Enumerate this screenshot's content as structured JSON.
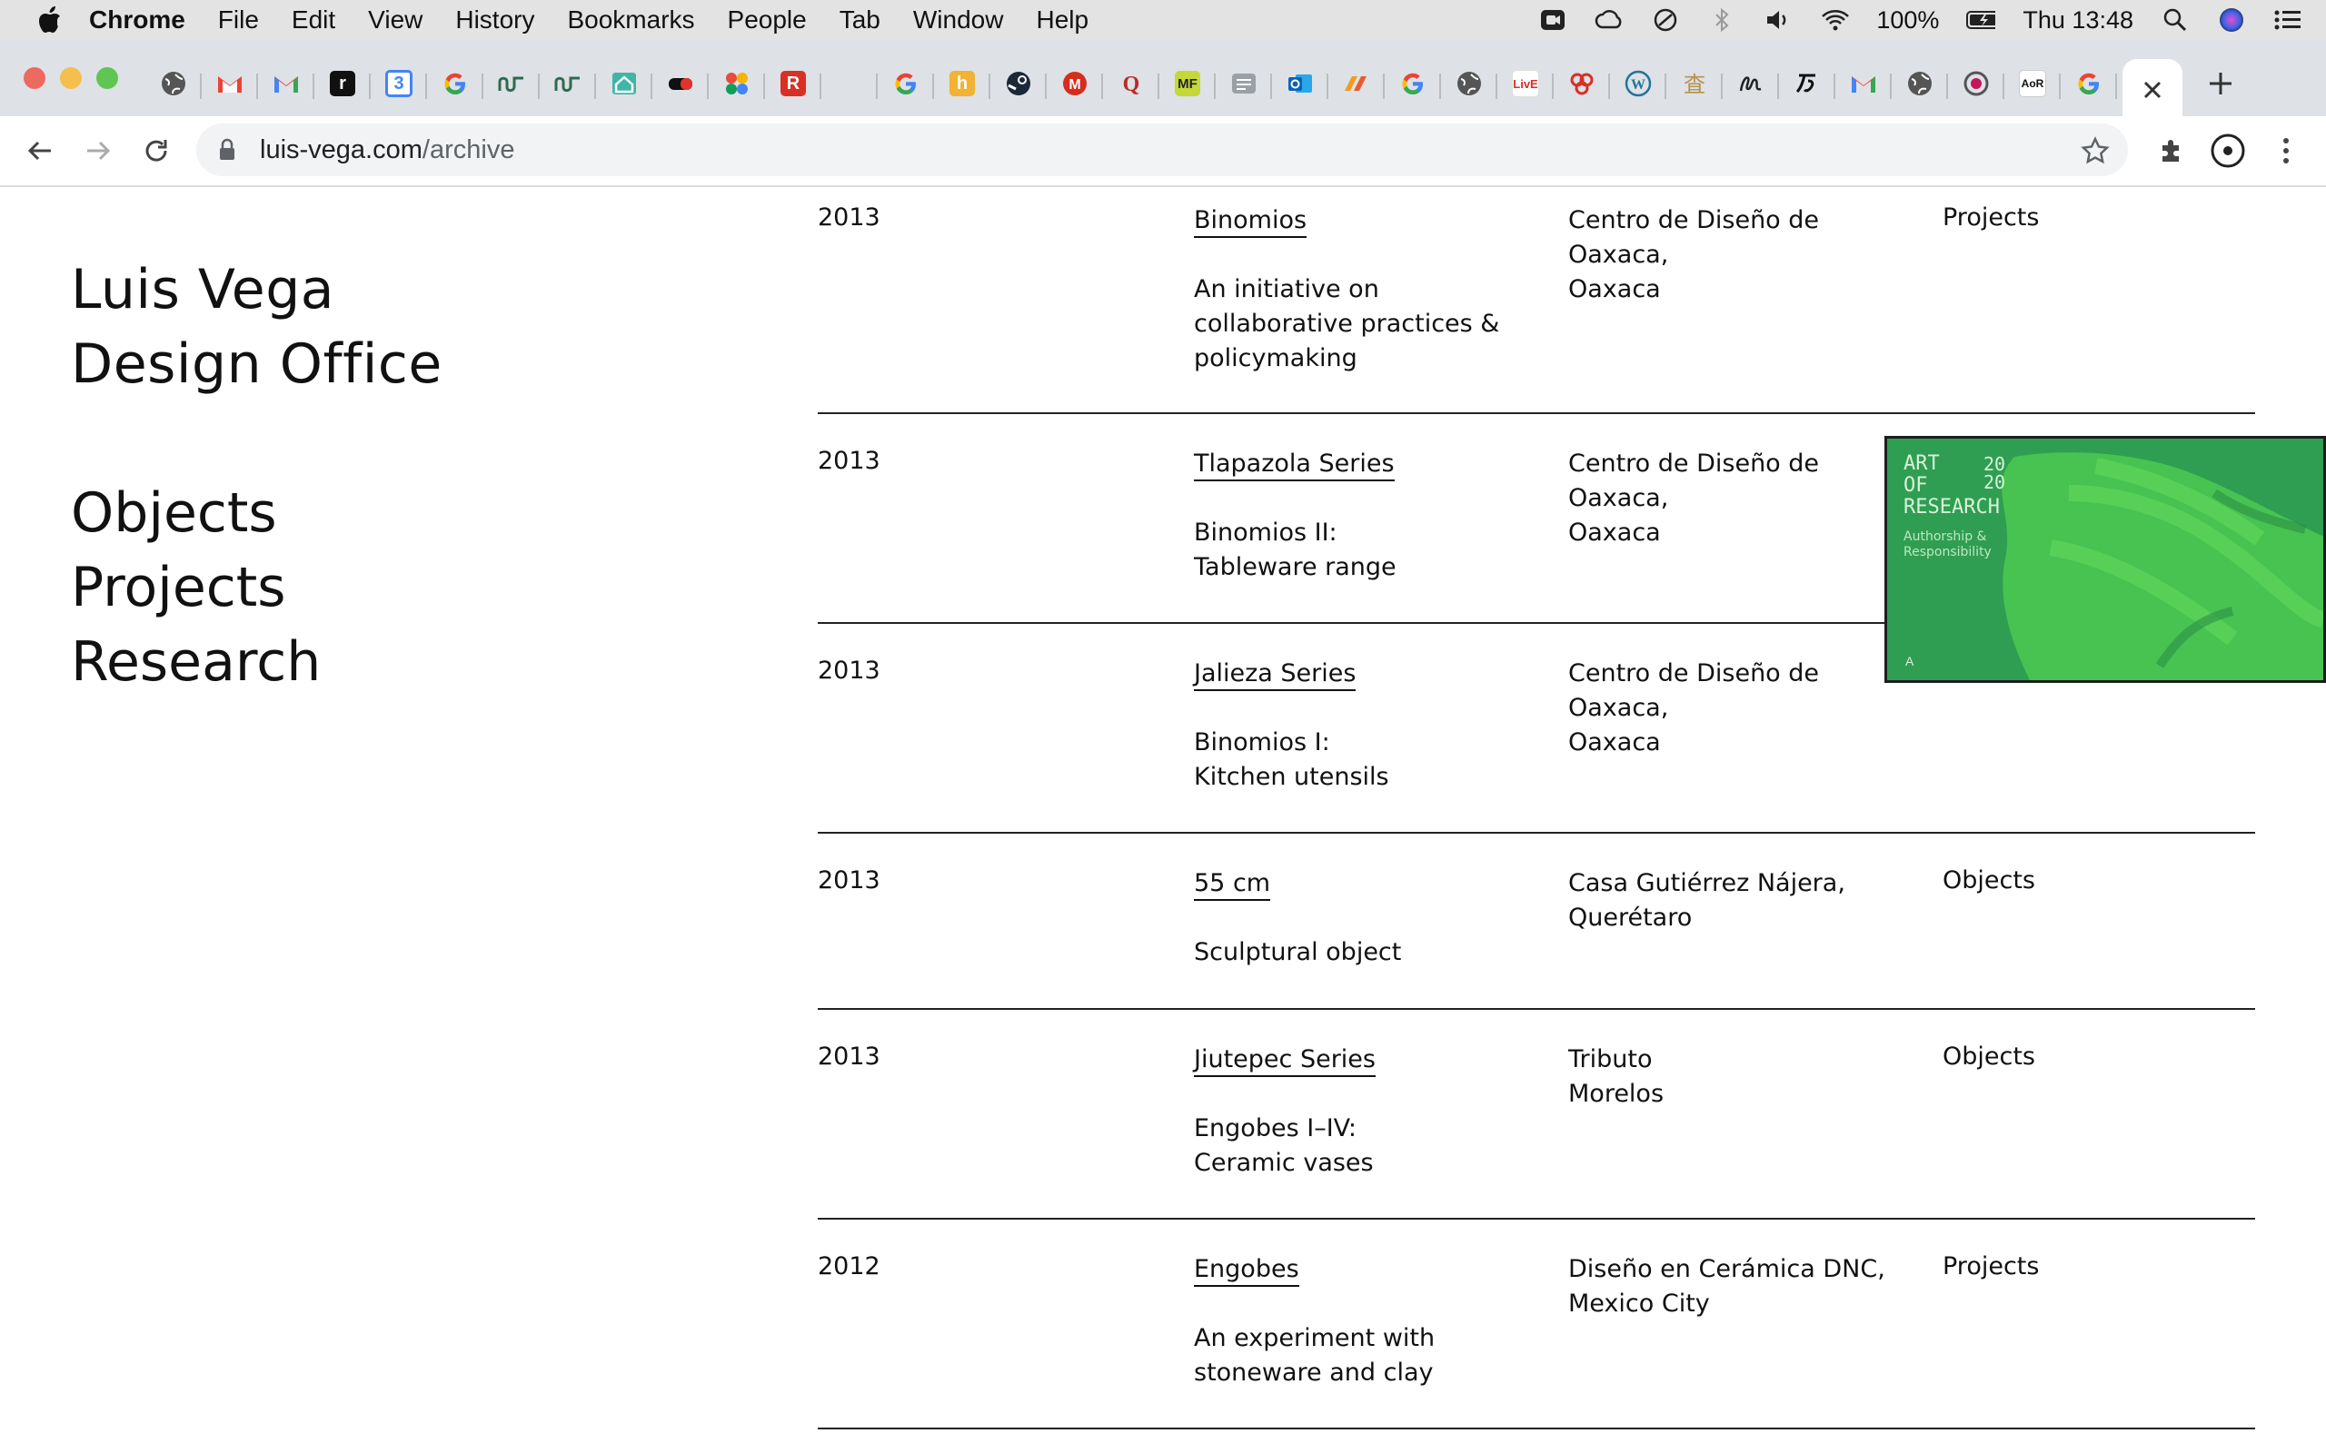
{
  "menubar": {
    "app": "Chrome",
    "items": [
      "File",
      "Edit",
      "View",
      "History",
      "Bookmarks",
      "People",
      "Tab",
      "Window",
      "Help"
    ],
    "battery": "100%",
    "clock": "Thu 13:48"
  },
  "browser": {
    "url_host": "luis-vega.com",
    "url_path": "/archive"
  },
  "site": {
    "brand_line1": "Luis Vega",
    "brand_line2": "Design Office",
    "nav": [
      "Objects",
      "Projects",
      "Research"
    ]
  },
  "archive": [
    {
      "year": "2013",
      "title": "Binomios",
      "desc": [
        "An initiative on",
        "collaborative practices &",
        "policymaking"
      ],
      "place": [
        "Centro de Diseño de",
        "Oaxaca,",
        "Oaxaca"
      ],
      "category": "Projects"
    },
    {
      "year": "2013",
      "title": "Tlapazola Series",
      "desc": [
        "Binomios II:",
        "Tableware range"
      ],
      "place": [
        "Centro de Diseño de",
        "Oaxaca,",
        "Oaxaca"
      ],
      "category": ""
    },
    {
      "year": "2013",
      "title": "Jalieza Series",
      "desc": [
        "Binomios I:",
        "Kitchen utensils"
      ],
      "place": [
        "Centro de Diseño de",
        "Oaxaca,",
        "Oaxaca"
      ],
      "category": ""
    },
    {
      "year": "2013",
      "title": "55 cm",
      "desc": [
        "Sculptural object"
      ],
      "place": [
        "Casa Gutiérrez Nájera,",
        "Querétaro"
      ],
      "category": "Objects"
    },
    {
      "year": "2013",
      "title": "Jiutepec Series",
      "desc": [
        "Engobes I–IV:",
        "Ceramic vases"
      ],
      "place": [
        "Tributo",
        "Morelos"
      ],
      "category": "Objects"
    },
    {
      "year": "2012",
      "title": "Engobes",
      "desc": [
        "An experiment with",
        "stoneware and clay"
      ],
      "place": [
        "Diseño en Cerámica DNC,",
        "Mexico City"
      ],
      "category": "Projects"
    }
  ],
  "preview": {
    "title_lines": [
      "ART",
      "OF",
      "RESEARCH"
    ],
    "year_lines": [
      "20",
      "20"
    ],
    "subtitle_lines": [
      "Authorship &",
      "Responsibility"
    ],
    "bg_color": "#2aa24a"
  }
}
